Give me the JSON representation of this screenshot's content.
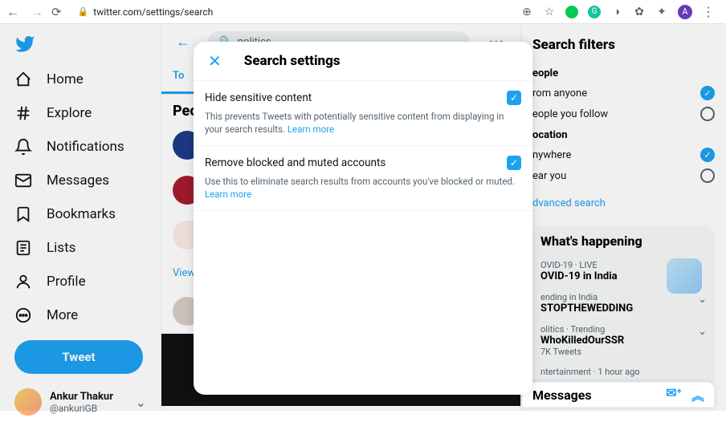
{
  "browser": {
    "url": "twitter.com/settings/search",
    "avatar_letter": "A"
  },
  "sidebar": {
    "items": [
      {
        "label": "Home"
      },
      {
        "label": "Explore"
      },
      {
        "label": "Notifications"
      },
      {
        "label": "Messages"
      },
      {
        "label": "Bookmarks"
      },
      {
        "label": "Lists"
      },
      {
        "label": "Profile"
      },
      {
        "label": "More"
      }
    ],
    "tweet_label": "Tweet",
    "profile": {
      "name": "Ankur Thakur",
      "handle": "@ankuriGB"
    }
  },
  "main": {
    "search_value": "politics",
    "active_tab": "To",
    "people_heading": "Peo",
    "view_all": "View a"
  },
  "right": {
    "filters_title": "Search filters",
    "people_section": "eople",
    "opt_anyone": "rom anyone",
    "opt_follow": "eople you follow",
    "location_section": "ocation",
    "opt_anywhere": "nywhere",
    "opt_near": "ear you",
    "advanced": "dvanced search",
    "whats_title": "What's happening",
    "trends": [
      {
        "meta": "OVID-19 · LIVE",
        "title": "OVID-19 in India"
      },
      {
        "meta": "ending in India",
        "title": "STOPTHEWEDDING"
      },
      {
        "meta": "olitics · Trending",
        "title": "WhoKilledOurSSR",
        "count": "7K Tweets"
      },
      {
        "meta": "ntertainment · 1 hour ago",
        "title": ""
      }
    ]
  },
  "messages_dock": "Messages",
  "modal": {
    "title": "Search settings",
    "settings": [
      {
        "label": "Hide sensitive content",
        "desc": "This prevents Tweets with potentially sensitive content from displaying in your search results.",
        "learn": "Learn more"
      },
      {
        "label": "Remove blocked and muted accounts",
        "desc": "Use this to eliminate search results from accounts you've blocked or muted.",
        "learn": "Learn more"
      }
    ]
  }
}
